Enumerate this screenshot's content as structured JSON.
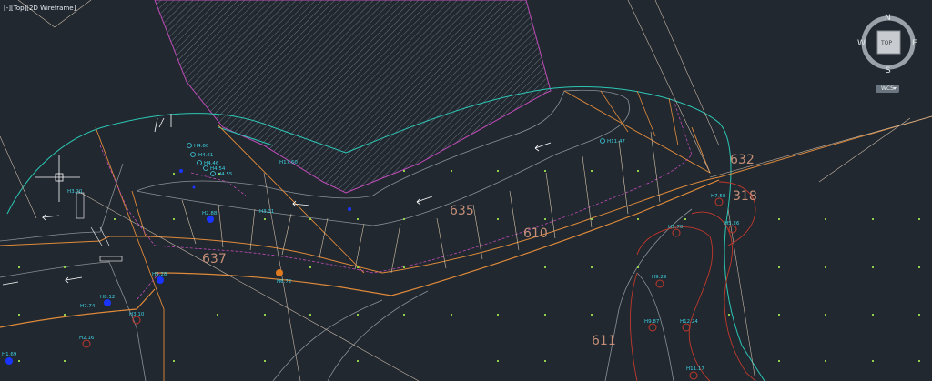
{
  "viewport": {
    "control_menu": "[-]",
    "view": "[Top]",
    "visual_style": "[2D Wireframe]"
  },
  "viewcube": {
    "north": "N",
    "south": "S",
    "east": "E",
    "west": "W",
    "face": "TOP",
    "ucs_menu": "WCS"
  },
  "parcel_numbers": [
    "632",
    "318",
    "635",
    "610",
    "637",
    "611"
  ],
  "spot_heights": [
    "H4.60",
    "H4.61",
    "H4.46",
    "H4.54",
    "H4.55",
    "H17.60",
    "H11.47",
    "H2.88",
    "H3.31",
    "H5.28",
    "H6.72",
    "H8.12",
    "H7.74",
    "H3.10",
    "H2.16",
    "H1.69",
    "H7.58",
    "H5.26",
    "H9.70",
    "H9.29",
    "H9.87",
    "H12.24",
    "H11.17",
    "H3.20"
  ],
  "colors": {
    "background": "#212830",
    "road_orange": "#e08a3a",
    "boundary_cyan": "#2cc7b5",
    "contour_red": "#c0392b",
    "magenta": "#c04bb8",
    "parcel_text": "#c58f78",
    "label_cyan": "#3fd0e0"
  }
}
